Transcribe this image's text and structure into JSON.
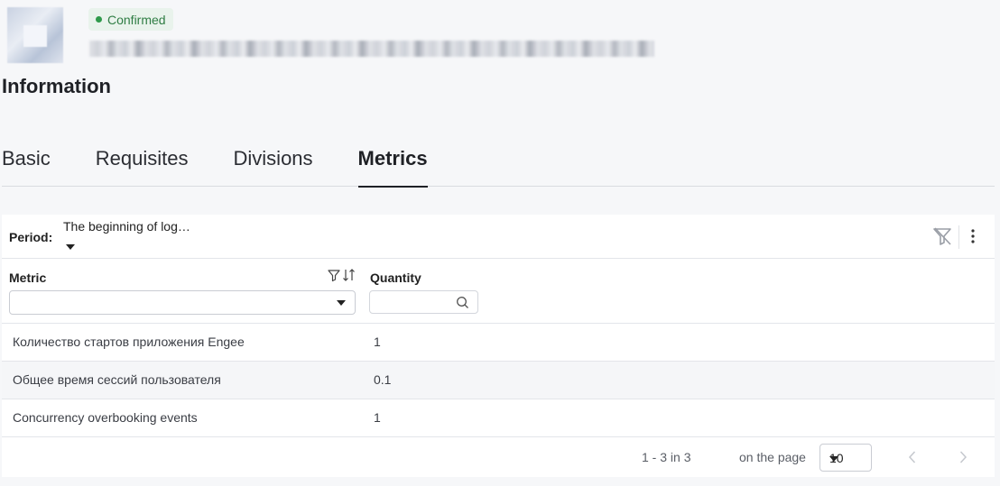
{
  "header": {
    "status": "Confirmed",
    "title": "Information"
  },
  "tabs": [
    {
      "label": "Basic",
      "active": false
    },
    {
      "label": "Requisites",
      "active": false
    },
    {
      "label": "Divisions",
      "active": false
    },
    {
      "label": "Metrics",
      "active": true
    }
  ],
  "toolbar": {
    "period_label": "Period:",
    "period_value": "The beginning of log…",
    "icons": [
      "filter-off-icon",
      "more-vertical-icon"
    ]
  },
  "table": {
    "columns": [
      "Metric",
      "Quantity"
    ],
    "metric_filter_value": "",
    "quantity_filter_value": "",
    "rows": [
      {
        "metric": "Количество стартов приложения Engee",
        "quantity": "1"
      },
      {
        "metric": "Общее время сессий пользователя",
        "quantity": "0.1"
      },
      {
        "metric": "Concurrency overbooking events",
        "quantity": "1"
      }
    ]
  },
  "pager": {
    "range": "1 - 3 in 3",
    "per_page_label": "on the page",
    "per_page_value": "10"
  },
  "colors": {
    "status_green": "#2f9a4b",
    "badge_bg": "#e9f3ec",
    "page_bg": "#f6f7f9"
  }
}
